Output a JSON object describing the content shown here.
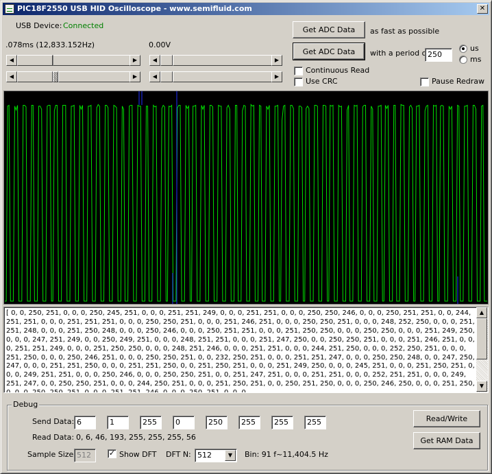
{
  "window": {
    "title": "PIC18F2550 USB HID Oscilloscope - www.semifluid.com",
    "close_label": "✕"
  },
  "usb": {
    "label": "USB Device:",
    "status": "Connected",
    "status_color": "#008000"
  },
  "readouts": {
    "time": ".078ms (12,833.152Hz)",
    "voltage": "0.00V"
  },
  "buttons": {
    "get_adc_fast": "Get ADC Data",
    "fast_caption": "as fast as possible",
    "get_adc_period": "Get ADC Data",
    "period_caption": "with a period of",
    "read_write": "Read/Write",
    "get_ram": "Get RAM Data"
  },
  "period": {
    "value": "250",
    "unit_us": "us",
    "unit_ms": "ms",
    "selected": "us"
  },
  "checkboxes": {
    "continuous_read": {
      "label": "Continuous Read",
      "checked": false
    },
    "use_crc": {
      "label": "Use CRC",
      "checked": false
    },
    "pause_redraw": {
      "label": "Pause Redraw",
      "checked": false
    },
    "show_dft": {
      "label": "Show DFT",
      "checked": true
    }
  },
  "scope": {
    "trace_color": "#00e000",
    "dft_color": "#2030ff",
    "data_text": "[ 0, 0, 250, 251, 0, 0, 0, 250, 245, 251, 0, 0, 0, 251, 251, 249, 0, 0, 0, 251, 251, 0, 0, 0, 250, 250, 246, 0, 0, 0, 250, 251, 251, 0, 0, 244, 251, 251, 0, 0, 0, 251, 251, 251, 0, 0, 0, 250, 250, 251, 0, 0, 0, 251, 246, 251, 0, 0, 0, 250, 250, 251, 0, 0, 0, 248, 252, 250, 0, 0, 0, 251, 251, 248, 0, 0, 0, 251, 250, 248, 0, 0, 0, 250, 246, 0, 0, 0, 250, 251, 251, 0, 0, 0, 251, 250, 250, 0, 0, 0, 250, 250, 0, 0, 0, 251, 249, 250, 0, 0, 0, 247, 251, 249, 0, 0, 250, 249, 251, 0, 0, 0, 248, 251, 251, 0, 0, 0, 251, 247, 250, 0, 0, 250, 250, 251, 0, 0, 0, 251, 246, 251, 0, 0, 0, 251, 251, 249, 0, 0, 0, 251, 250, 250, 0, 0, 0, 248, 251, 246, 0, 0, 0, 251, 251, 0, 0, 0, 244, 251, 250, 0, 0, 0, 252, 250, 251, 0, 0, 0, 251, 250, 0, 0, 0, 250, 246, 251, 0, 0, 0, 250, 250, 251, 0, 0, 232, 250, 251, 0, 0, 0, 251, 251, 247, 0, 0, 0, 250, 250, 248, 0, 0, 247, 250, 247, 0, 0, 0, 251, 251, 250, 0, 0, 0, 251, 251, 250, 0, 0, 251, 250, 251, 0, 0, 0, 251, 249, 250, 0, 0, 0, 245, 251, 0, 0, 0, 251, 250, 251, 0, 0, 0, 249, 251, 251, 0, 0, 0, 250, 246, 0, 0, 0, 250, 250, 251, 0, 0, 251, 247, 251, 0, 0, 0, 251, 251, 0, 0, 0, 252, 251, 251, 0, 0, 0, 249, 251, 247, 0, 0, 250, 250, 251, 0, 0, 0, 244, 250, 251, 0, 0, 0, 251, 250, 251, 0, 0, 250, 251, 250, 0, 0, 0, 250, 246, 250, 0, 0, 0, 251, 250, 0, 0, 0, 250, 250, 251, 0, 0, 0, 251, 251, 246, 0, 0, 0, 250, 251, 0, 0, 0,"
  },
  "debug": {
    "title": "Debug",
    "send_label": "Send Data:",
    "send_values": [
      "6",
      "1",
      "255",
      "0",
      "250",
      "255",
      "255",
      "255"
    ],
    "read_label": "Read Data:",
    "read_value": "0, 6, 46, 193, 255, 255, 255, 56",
    "sample_label": "Sample Size:",
    "sample_value": "512",
    "dft_label": "DFT N:",
    "dft_value": "512",
    "bin_text": "Bin: 91 f~11,404.5 Hz"
  },
  "icons": {
    "scroll_left": "◀",
    "scroll_right": "▶",
    "scroll_up": "▲",
    "scroll_down": "▼",
    "combo_down": "▼",
    "check_mark": "✓"
  }
}
